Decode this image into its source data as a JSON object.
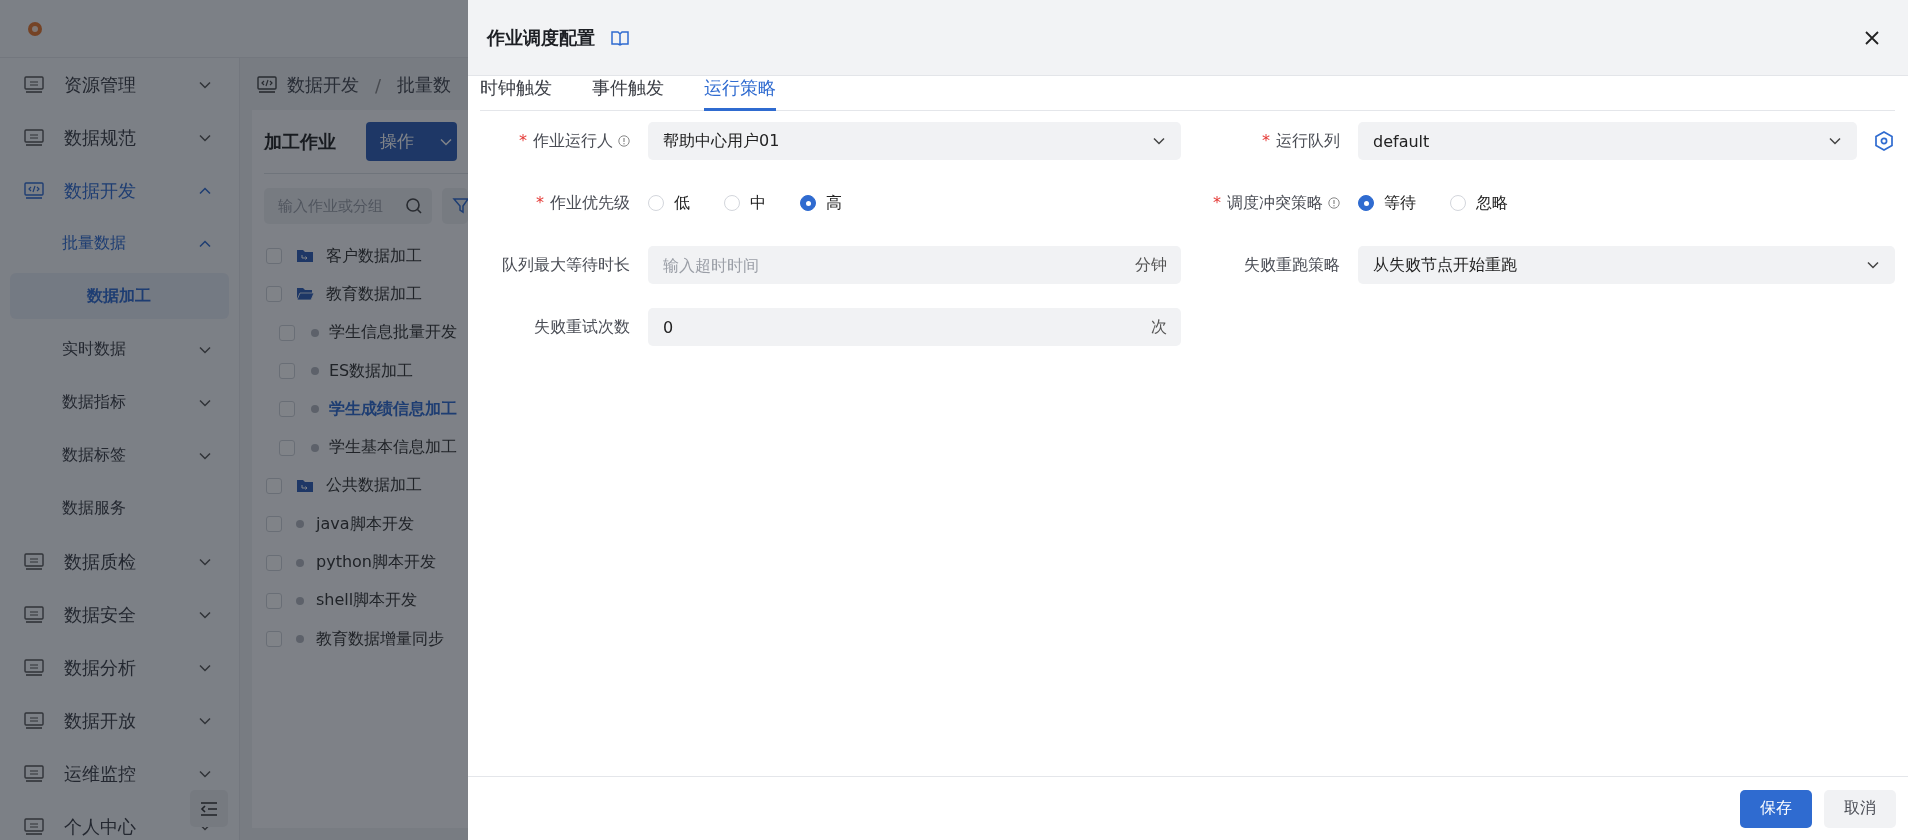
{
  "sidebar": {
    "items": [
      {
        "label": "资源管理",
        "expanded": false,
        "selected": false
      },
      {
        "label": "数据规范",
        "expanded": false,
        "selected": false
      },
      {
        "label": "数据开发",
        "expanded": true,
        "selected": true,
        "children": [
          {
            "label": "批量数据",
            "expanded": true,
            "selected": true,
            "children": [
              {
                "label": "数据加工",
                "selected": true
              }
            ]
          },
          {
            "label": "实时数据",
            "expanded": false,
            "selected": false
          },
          {
            "label": "数据指标",
            "expanded": false,
            "selected": false
          },
          {
            "label": "数据标签",
            "expanded": false,
            "selected": false
          },
          {
            "label": "数据服务",
            "selected": false
          }
        ]
      },
      {
        "label": "数据质检",
        "expanded": false,
        "selected": false
      },
      {
        "label": "数据安全",
        "expanded": false,
        "selected": false
      },
      {
        "label": "数据分析",
        "expanded": false,
        "selected": false
      },
      {
        "label": "数据开放",
        "expanded": false,
        "selected": false
      },
      {
        "label": "运维监控",
        "expanded": false,
        "selected": false
      },
      {
        "label": "个人中心",
        "expanded": false,
        "selected": false
      }
    ]
  },
  "workspace": {
    "breadcrumb": [
      "数据开发",
      "批量数"
    ],
    "breadcrumb_separator": "/",
    "panel": {
      "title": "加工作业",
      "action": "操作",
      "search_placeholder": "输入作业或分组",
      "tree": [
        {
          "kind": "folder",
          "label": "客户数据加工",
          "expanded": false,
          "checked": false,
          "selected": false
        },
        {
          "kind": "folder",
          "label": "教育数据加工",
          "expanded": true,
          "checked": false,
          "selected": false,
          "children": [
            {
              "kind": "job",
              "label": "学生信息批量开发",
              "checked": false,
              "selected": false
            },
            {
              "kind": "job",
              "label": "ES数据加工",
              "checked": false,
              "selected": false
            },
            {
              "kind": "job",
              "label": "学生成绩信息加工",
              "checked": false,
              "selected": true
            },
            {
              "kind": "job",
              "label": "学生基本信息加工",
              "checked": false,
              "selected": false
            }
          ]
        },
        {
          "kind": "folder",
          "label": "公共数据加工",
          "expanded": false,
          "checked": false,
          "selected": false
        },
        {
          "kind": "job",
          "label": "java脚本开发",
          "checked": false,
          "selected": false
        },
        {
          "kind": "job",
          "label": "python脚本开发",
          "checked": false,
          "selected": false
        },
        {
          "kind": "job",
          "label": "shell脚本开发",
          "checked": false,
          "selected": false
        },
        {
          "kind": "job",
          "label": "教育数据增量同步",
          "checked": false,
          "selected": false
        }
      ]
    }
  },
  "drawer": {
    "title": "作业调度配置",
    "tabs": [
      {
        "label": "时钟触发",
        "selected": false
      },
      {
        "label": "事件触发",
        "selected": false
      },
      {
        "label": "运行策略",
        "selected": true
      }
    ],
    "fields": [
      {
        "kind": "select",
        "required_mark": "*",
        "label": "作业运行人",
        "info": true,
        "value": "帮助中心用户01",
        "settings": false
      },
      {
        "kind": "select",
        "required_mark": "*",
        "label": "运行队列",
        "info": false,
        "value": "default",
        "settings": true
      },
      {
        "kind": "radio",
        "required_mark": "*",
        "label": "作业优先级",
        "info": false,
        "options": [
          {
            "label": "低",
            "selected": false
          },
          {
            "label": "中",
            "selected": false
          },
          {
            "label": "高",
            "selected": true
          }
        ]
      },
      {
        "kind": "radio",
        "required_mark": "*",
        "label": "调度冲突策略",
        "info": true,
        "options": [
          {
            "label": "等待",
            "selected": true
          },
          {
            "label": "忽略",
            "selected": false
          }
        ]
      },
      {
        "kind": "input",
        "label": "队列最大等待时长",
        "info": false,
        "placeholder": "输入超时时间",
        "suffix": "分钟"
      },
      {
        "kind": "select",
        "label": "失败重跑策略",
        "info": false,
        "value": "从失败节点开始重跑",
        "settings": false
      },
      {
        "kind": "input",
        "label": "失败重试次数",
        "info": false,
        "value": "0",
        "suffix": "次"
      }
    ],
    "buttons": [
      {
        "kind": "primary",
        "label": "保存"
      },
      {
        "kind": "default",
        "label": "取消"
      }
    ]
  }
}
